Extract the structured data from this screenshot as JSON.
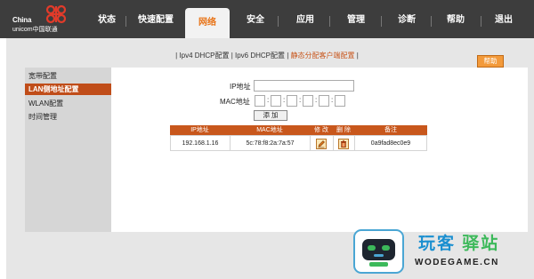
{
  "logo": {
    "name_cn": "China",
    "name_en": "unicom中国联通"
  },
  "nav": {
    "items": [
      {
        "label": "状态"
      },
      {
        "label": "快速配置"
      },
      {
        "label": "网络",
        "active": true
      },
      {
        "label": "安全"
      },
      {
        "label": "应用"
      },
      {
        "label": "管理"
      },
      {
        "label": "诊断"
      },
      {
        "label": "帮助"
      },
      {
        "label": "退出"
      }
    ]
  },
  "subnav": {
    "sep": "|",
    "items": [
      {
        "label": "Ipv4 DHCP配置"
      },
      {
        "label": "Ipv6 DHCP配置"
      },
      {
        "label": "静态分配客户端配置",
        "active": true
      }
    ]
  },
  "help_button": {
    "label": "帮助"
  },
  "sidebar": {
    "items": [
      {
        "label": "宽带配置"
      },
      {
        "label": "LAN侧地址配置",
        "active": true
      },
      {
        "label": "WLAN配置"
      },
      {
        "label": "时间管理"
      }
    ]
  },
  "form": {
    "ip_label": "IP地址",
    "ip_value": "",
    "mac_label": "MAC地址",
    "mac_colon": ":",
    "mac_segments": [
      "",
      "",
      "",
      "",
      "",
      ""
    ],
    "add_label": "添 加"
  },
  "table": {
    "headers": [
      "IP地址",
      "MAC地址",
      "修 改",
      "删 除",
      "备注"
    ],
    "rows": [
      {
        "ip": "192.168.1.16",
        "mac": "5c:78:f8:2a:7a:57",
        "note": "0a9fad8ec0e9"
      }
    ]
  },
  "watermark": {
    "title_a": "玩客",
    "title_b": "驿站",
    "subtitle": "WODEGAME.CN"
  },
  "colors": {
    "nav_bg": "#3d3d3d",
    "accent": "#c8571c",
    "active_tab_text": "#e8751a",
    "help_button": "#f39a3a",
    "watermark_blue": "#1a8fd0",
    "watermark_green": "#3cb95a"
  }
}
